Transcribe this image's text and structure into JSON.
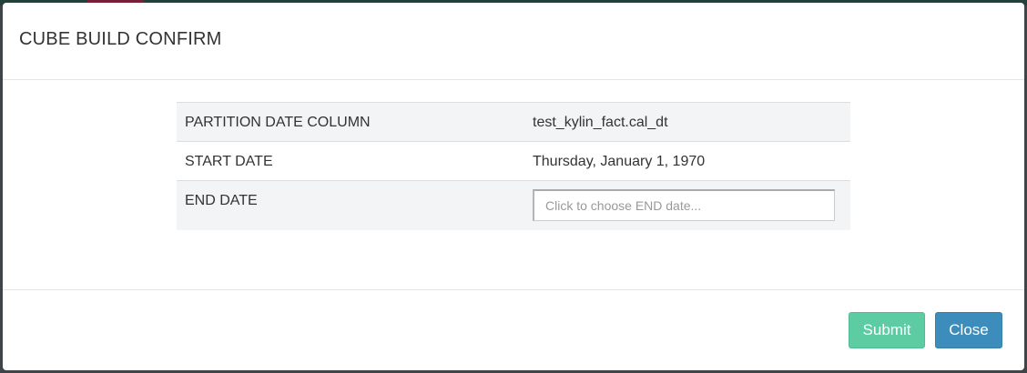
{
  "modal": {
    "title": "CUBE BUILD CONFIRM"
  },
  "table": {
    "rows": [
      {
        "label": "PARTITION DATE COLUMN",
        "value": "test_kylin_fact.cal_dt"
      },
      {
        "label": "START DATE",
        "value": "Thursday, January 1, 1970"
      },
      {
        "label": "END DATE",
        "value": "",
        "placeholder": "Click to choose END date..."
      }
    ]
  },
  "footer": {
    "submit_label": "Submit",
    "close_label": "Close"
  },
  "colors": {
    "submit": "#5dcca2",
    "close": "#3c8dbc"
  }
}
